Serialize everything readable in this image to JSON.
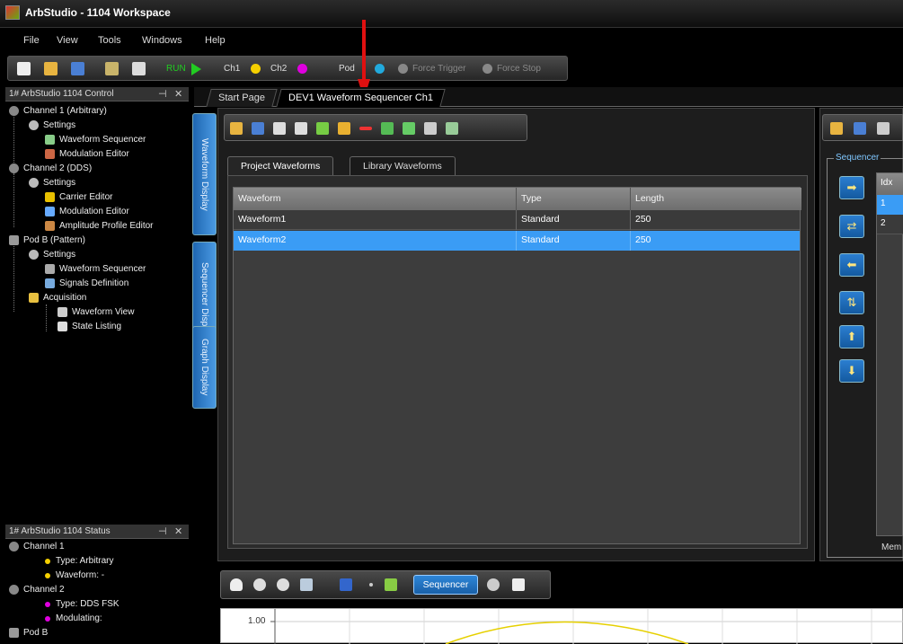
{
  "window": {
    "title": "ArbStudio - 1104 Workspace"
  },
  "menu": [
    "File",
    "View",
    "Tools",
    "Windows",
    "Help"
  ],
  "toolbar": {
    "run_label": "RUN",
    "ch1_label": "Ch1",
    "ch2_label": "Ch2",
    "pod_label": "Pod",
    "force_trigger_label": "Force Trigger",
    "force_stop_label": "Force Stop"
  },
  "control_panel": {
    "title": "1# ArbStudio 1104 Control",
    "items": [
      {
        "label": "Channel 1 (Arbitrary)",
        "icon": "gear-icon"
      },
      {
        "label": "Settings",
        "icon": "gear-icon"
      },
      {
        "label": "Waveform Sequencer",
        "icon": "list-icon"
      },
      {
        "label": "Modulation Editor",
        "icon": "wave-icon"
      },
      {
        "label": "Channel 2 (DDS)",
        "icon": "gear-icon"
      },
      {
        "label": "Settings",
        "icon": "gear-icon"
      },
      {
        "label": "Carrier Editor",
        "icon": "wave-icon"
      },
      {
        "label": "Modulation Editor",
        "icon": "wave-icon"
      },
      {
        "label": "Amplitude Profile Editor",
        "icon": "wave-icon"
      },
      {
        "label": "Pod B (Pattern)",
        "icon": "pod-icon"
      },
      {
        "label": "Settings",
        "icon": "gear-icon"
      },
      {
        "label": "Waveform Sequencer",
        "icon": "list-icon"
      },
      {
        "label": "Signals Definition",
        "icon": "signals-icon"
      },
      {
        "label": "Acquisition",
        "icon": "folder-icon"
      },
      {
        "label": "Waveform View",
        "icon": "view-icon"
      },
      {
        "label": "State Listing",
        "icon": "listing-icon"
      }
    ]
  },
  "status_panel": {
    "title": "1# ArbStudio 1104 Status",
    "items": [
      {
        "label": "Channel 1"
      },
      {
        "label": "Type: Arbitrary"
      },
      {
        "label": "Waveform: -"
      },
      {
        "label": "Channel 2"
      },
      {
        "label": "Type: DDS FSK"
      },
      {
        "label": "Modulating:"
      },
      {
        "label": "Pod B"
      }
    ]
  },
  "side_tabs": [
    "Waveform Display",
    "Sequencer Display",
    "Graph Display"
  ],
  "doc_tabs": [
    "Start Page",
    "DEV1 Waveform Sequencer Ch1"
  ],
  "waveform_tabs": [
    "Project Waveforms",
    "Library Waveforms"
  ],
  "table": {
    "headers": [
      "Waveform",
      "Type",
      "Length"
    ],
    "rows": [
      {
        "waveform": "Waveform1",
        "type": "Standard",
        "length": "250"
      },
      {
        "waveform": "Waveform2",
        "type": "Standard",
        "length": "250"
      }
    ]
  },
  "sequencer": {
    "label": "Sequencer",
    "list_header": "Idx",
    "list_rows": [
      "1",
      "2"
    ],
    "memory_label": "Mem"
  },
  "graph": {
    "sequencer_button": "Sequencer",
    "y_tick": "1.00"
  },
  "colors": {
    "accent": "#3a8ee6",
    "selected_row": "#3a9cf5",
    "ch1": "#f5d000",
    "ch2": "#e000e0",
    "run": "#22cc22"
  }
}
